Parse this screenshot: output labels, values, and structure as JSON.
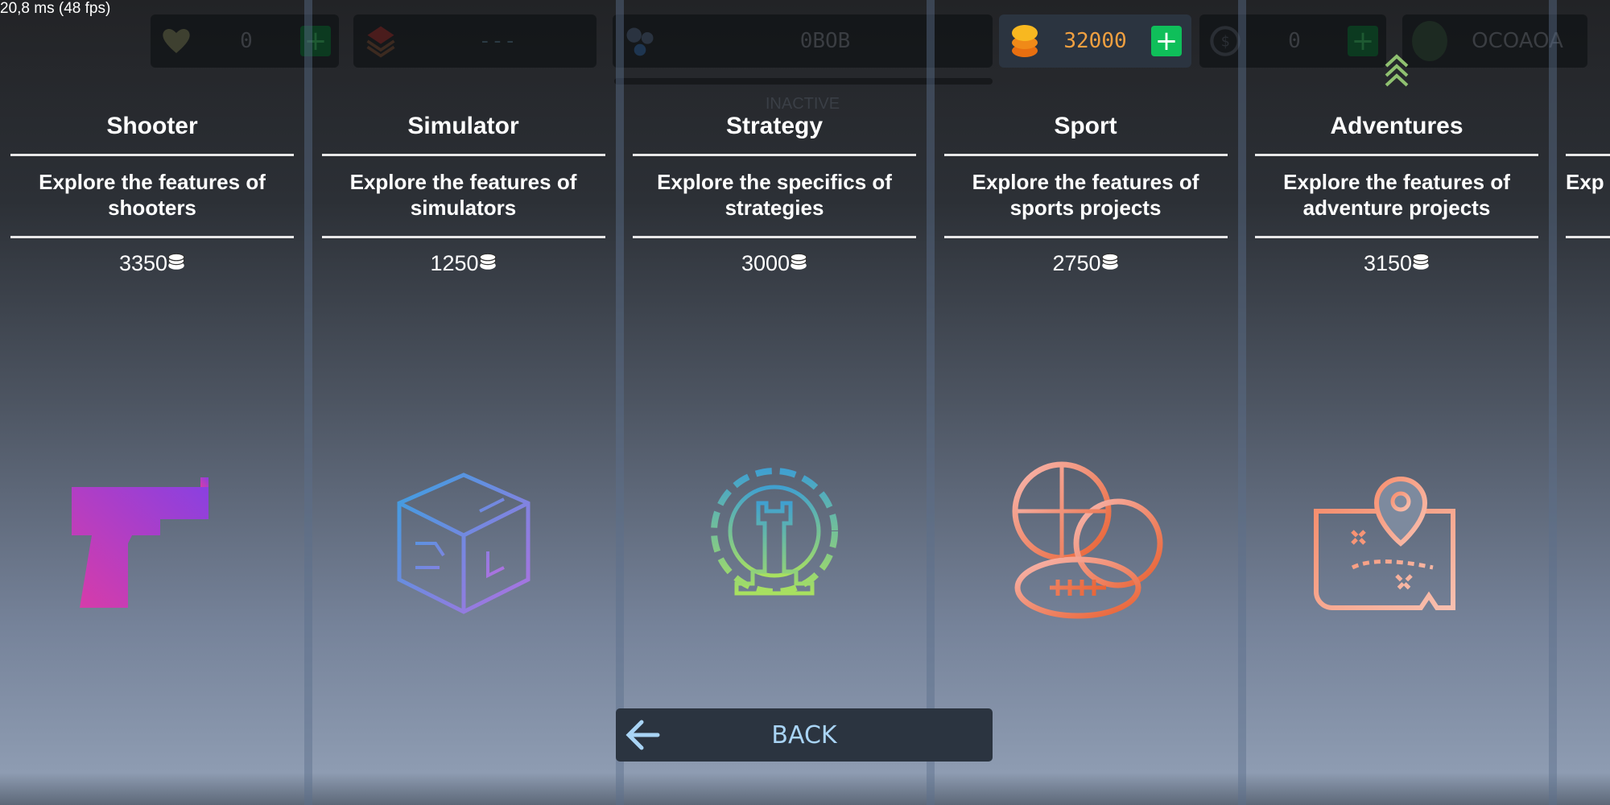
{
  "debug": {
    "fps_text": "20,8 ms (48 fps)"
  },
  "topbar": {
    "hearts": {
      "icon": "heart-icon",
      "value": "0"
    },
    "layers": {
      "icon": "layers-icon",
      "value": "---"
    },
    "bob": {
      "icon": "nodes-icon",
      "value": "0BOB",
      "status": "INACTIVE"
    },
    "coins": {
      "icon": "coins-icon",
      "value": "32000",
      "color": "#f0a040"
    },
    "dollar": {
      "icon": "dollar-coin-icon",
      "value": "0"
    },
    "profile": {
      "icon": "avatar",
      "name": "OCOAOA"
    }
  },
  "cards": [
    {
      "title": "Shooter",
      "desc": "Explore the features of shooters",
      "price": "3350",
      "icon": "pistol-icon"
    },
    {
      "title": "Simulator",
      "desc": "Explore the features of simulators",
      "price": "1250",
      "icon": "circuit-cube-icon"
    },
    {
      "title": "Strategy",
      "desc": "Explore the specifics of strategies",
      "price": "3000",
      "icon": "chess-rook-gear-icon"
    },
    {
      "title": "Sport",
      "desc": "Explore the features of sports projects",
      "price": "2750",
      "icon": "sports-balls-icon"
    },
    {
      "title": "Adventures",
      "desc": "Explore the features of adventure projects",
      "price": "3150",
      "icon": "treasure-map-icon"
    },
    {
      "title": "",
      "desc": "Exp",
      "price": "",
      "icon": ""
    }
  ],
  "back_button": {
    "label": "BACK",
    "icon": "arrow-left-icon"
  }
}
